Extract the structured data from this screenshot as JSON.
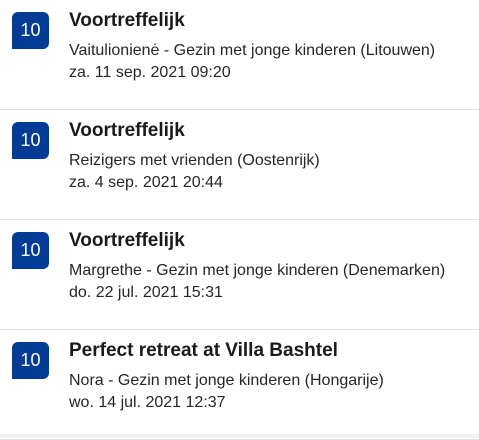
{
  "reviews": [
    {
      "score": "10",
      "title": "Voortreffelijk",
      "author": "Vaitulionienė - Gezin met jonge kinderen (Litouwen)",
      "date": "za. 11 sep. 2021 09:20"
    },
    {
      "score": "10",
      "title": "Voortreffelijk",
      "author": "Reizigers met vrienden (Oostenrijk)",
      "date": "za. 4 sep. 2021 20:44"
    },
    {
      "score": "10",
      "title": "Voortreffelijk",
      "author": "Margrethe - Gezin met jonge kinderen (Denemarken)",
      "date": "do. 22 jul. 2021 15:31"
    },
    {
      "score": "10",
      "title": "Perfect retreat at Villa Bashtel",
      "author": "Nora - Gezin met jonge kinderen (Hongarije)",
      "date": "wo. 14 jul. 2021 12:37"
    }
  ],
  "colors": {
    "score_badge": "#003b95",
    "divider": "#e3e3e3"
  }
}
